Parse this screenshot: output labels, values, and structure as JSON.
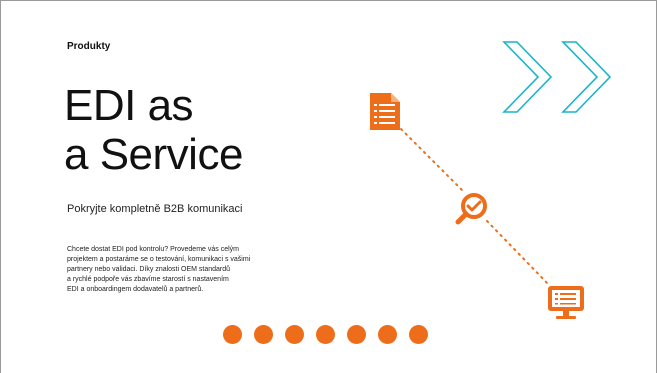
{
  "category": "Produkty",
  "headline": {
    "line1": "EDI as",
    "line2": "a Service"
  },
  "subtitle": "Pokryjte kompletně B2B komunikaci",
  "body_lines": [
    "Chcete dostat EDI pod kontrolu? Provedeme vás celým",
    "projektem a postaráme se o testování, komunikaci s vašimi",
    "partnery nebo validaci. Díky znalosti OEM standardů",
    "a rychlé podpoře vás zbavíme starostí s nastavením",
    "EDI a onboardingem dodavatelů a partnerů."
  ],
  "carousel": {
    "dot_count": 7
  },
  "icons": {
    "document": "document-icon",
    "magnifier": "magnifier-check-icon",
    "monitor": "monitor-icon",
    "chevrons": "double-chevron-right-icon"
  },
  "colors": {
    "accent": "#ee6d1a",
    "chevron": "#18b4cc",
    "text": "#111111"
  }
}
